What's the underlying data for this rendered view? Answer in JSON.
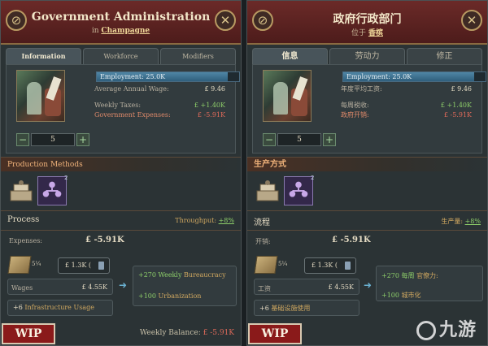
{
  "left": {
    "title": "Government Administration",
    "subtitle_prefix": "in",
    "location": "Champagne",
    "tabs": [
      "Information",
      "Workforce",
      "Modifiers"
    ],
    "employment": "Employment: 25.0K",
    "employment_ratio": 0.92,
    "stats": [
      {
        "label": "Average Annual Wage:",
        "value": "£ 9.46",
        "tone": "neutral"
      },
      {
        "label": "Weekly Taxes:",
        "value": "£ +1.40K",
        "tone": "pos"
      },
      {
        "label": "Government Expenses:",
        "value": "£ -5.91K",
        "tone": "neg"
      }
    ],
    "level": "5",
    "production_methods_title": "Production Methods",
    "pm_badge": "2",
    "process_title": "Process",
    "throughput_label": "Throughput:",
    "throughput_value": "+8%",
    "expenses_label": "Expenses:",
    "expenses_value": "£ -5.91K",
    "input_qty": "5¼",
    "input_cost": "£ 1.3K (",
    "wages_label": "Wages",
    "wages_value": "£ 4.55K",
    "output_1_amount": "+270 Weekly",
    "output_1_name": "Bureaucracy",
    "output_2_amount": "+100",
    "output_2_name": "Urbanization",
    "infra_amount": "+6",
    "infra_name": "Infrastructure Usage",
    "wip": "WIP",
    "balance_label": "Weekly Balance:",
    "balance_value": "£ -5.91K"
  },
  "right": {
    "title": "政府行政部门",
    "subtitle_prefix": "位于",
    "location": "香槟",
    "tabs": [
      "信息",
      "劳动力",
      "修正"
    ],
    "employment": "Employment: 25.0K",
    "employment_ratio": 0.92,
    "stats": [
      {
        "label": "年度平均工资:",
        "value": "£ 9.46",
        "tone": "neutral"
      },
      {
        "label": "每周税收:",
        "value": "£ +1.40K",
        "tone": "pos"
      },
      {
        "label": "政府开销:",
        "value": "£ -5.91K",
        "tone": "neg"
      }
    ],
    "level": "5",
    "production_methods_title": "生产方式",
    "pm_badge": "2",
    "process_title": "流程",
    "throughput_label": "生产量:",
    "throughput_value": "+8%",
    "expenses_label": "开销:",
    "expenses_value": "£ -5.91K",
    "input_qty": "5¼",
    "input_cost": "£ 1.3K (",
    "wages_label": "工资",
    "wages_value": "£ 4.55K",
    "output_1_amount": "+270 每周",
    "output_1_name": "官僚力:",
    "output_2_amount": "+100",
    "output_2_name": "城市化",
    "infra_amount": "+6",
    "infra_name": "基础设施使用",
    "wip": "WIP"
  },
  "watermark": "九游",
  "colors": {
    "header": "#5a2322",
    "accent_positive": "#8ecf6a",
    "accent_negative": "#e06a5a",
    "panel_bg": "#2b3335"
  }
}
